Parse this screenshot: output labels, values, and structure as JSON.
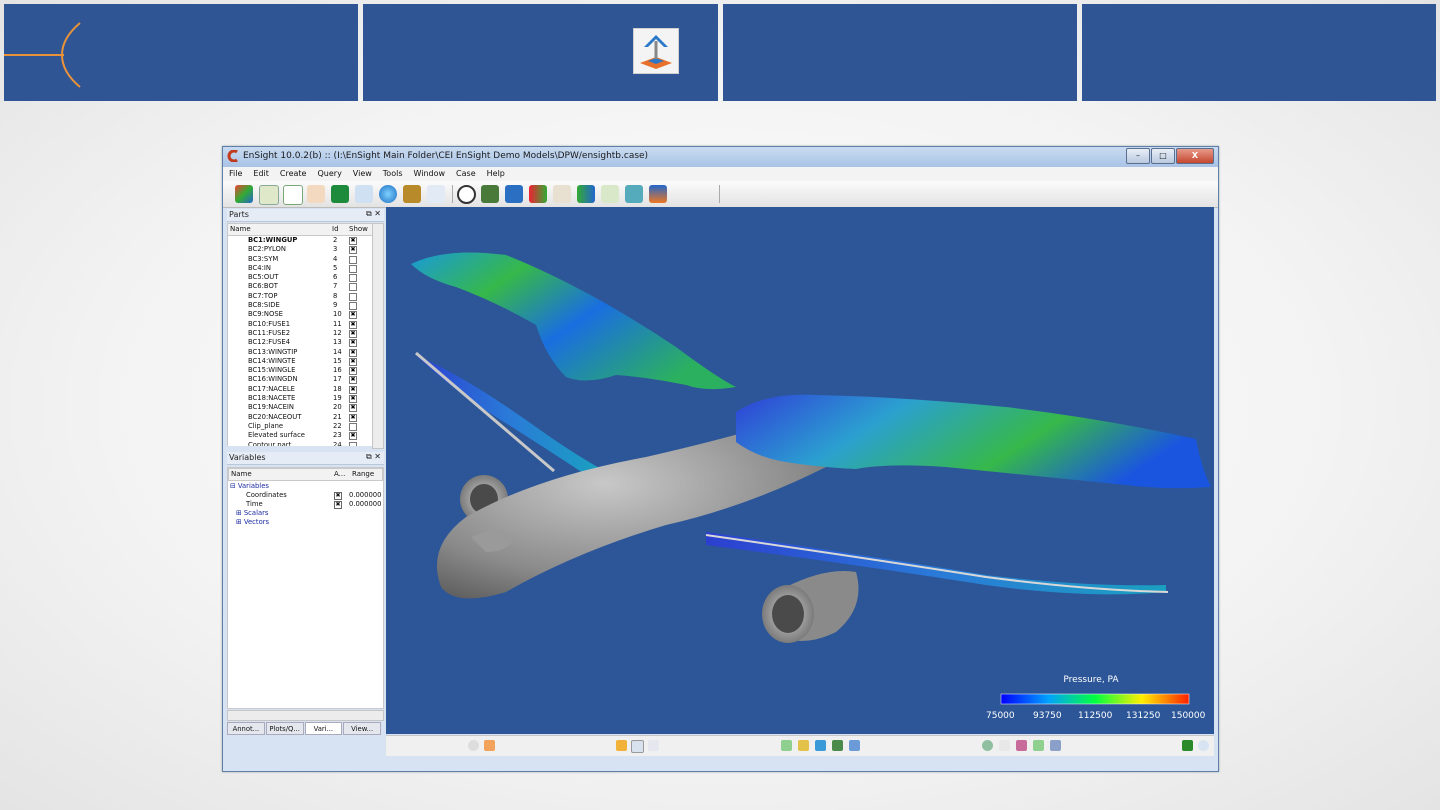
{
  "window": {
    "title": "EnSight 10.0.2(b) :: (I:\\EnSight Main Folder\\CEI EnSight Demo Models\\DPW/ensightb.case)",
    "buttons": [
      "–",
      "□",
      "X"
    ]
  },
  "menu": [
    "File",
    "Edit",
    "Create",
    "Query",
    "View",
    "Tools",
    "Window",
    "Case",
    "Help"
  ],
  "parts_panel": {
    "title": "Parts",
    "columns": [
      "Name",
      "Id",
      "Show"
    ],
    "rows": [
      {
        "name": "BC1:WINGUP",
        "id": "2",
        "show": true
      },
      {
        "name": "BC2:PYLON",
        "id": "3",
        "show": true
      },
      {
        "name": "BC3:SYM",
        "id": "4",
        "show": false
      },
      {
        "name": "BC4:IN",
        "id": "5",
        "show": false
      },
      {
        "name": "BC5:OUT",
        "id": "6",
        "show": false
      },
      {
        "name": "BC6:BOT",
        "id": "7",
        "show": false
      },
      {
        "name": "BC7:TOP",
        "id": "8",
        "show": false
      },
      {
        "name": "BC8:SIDE",
        "id": "9",
        "show": false
      },
      {
        "name": "BC9:NOSE",
        "id": "10",
        "show": true
      },
      {
        "name": "BC10:FUSE1",
        "id": "11",
        "show": true
      },
      {
        "name": "BC11:FUSE2",
        "id": "12",
        "show": true
      },
      {
        "name": "BC12:FUSE4",
        "id": "13",
        "show": true
      },
      {
        "name": "BC13:WINGTIP",
        "id": "14",
        "show": true
      },
      {
        "name": "BC14:WINGTE",
        "id": "15",
        "show": true
      },
      {
        "name": "BC15:WINGLE",
        "id": "16",
        "show": true
      },
      {
        "name": "BC16:WINGDN",
        "id": "17",
        "show": true
      },
      {
        "name": "BC17:NACELE",
        "id": "18",
        "show": true
      },
      {
        "name": "BC18:NACETE",
        "id": "19",
        "show": true
      },
      {
        "name": "BC19:NACEIN",
        "id": "20",
        "show": true
      },
      {
        "name": "BC20:NACEOUT",
        "id": "21",
        "show": true
      },
      {
        "name": "Clip_plane",
        "id": "22",
        "show": false
      },
      {
        "name": "Elevated surface",
        "id": "23",
        "show": true
      },
      {
        "name": "Contour part",
        "id": "24",
        "show": false
      }
    ]
  },
  "variables_panel": {
    "title": "Variables",
    "columns": [
      "Name",
      "A...",
      "Range"
    ],
    "root": "Variables",
    "items": [
      {
        "name": "Coordinates",
        "value": "0.000000"
      },
      {
        "name": "Time",
        "value": "0.000000"
      }
    ],
    "groups": [
      "Scalars",
      "Vectors"
    ]
  },
  "bottom_tabs": [
    "Annot...",
    "Plots/Q...",
    "Vari...",
    "View..."
  ],
  "legend": {
    "title": "Pressure, PA",
    "labels": [
      "75000",
      "93750",
      "112500",
      "131250",
      "150000"
    ]
  },
  "colors": {
    "header": "#2f5594",
    "viewport": "#2c5697",
    "accent": "#e8923a"
  }
}
